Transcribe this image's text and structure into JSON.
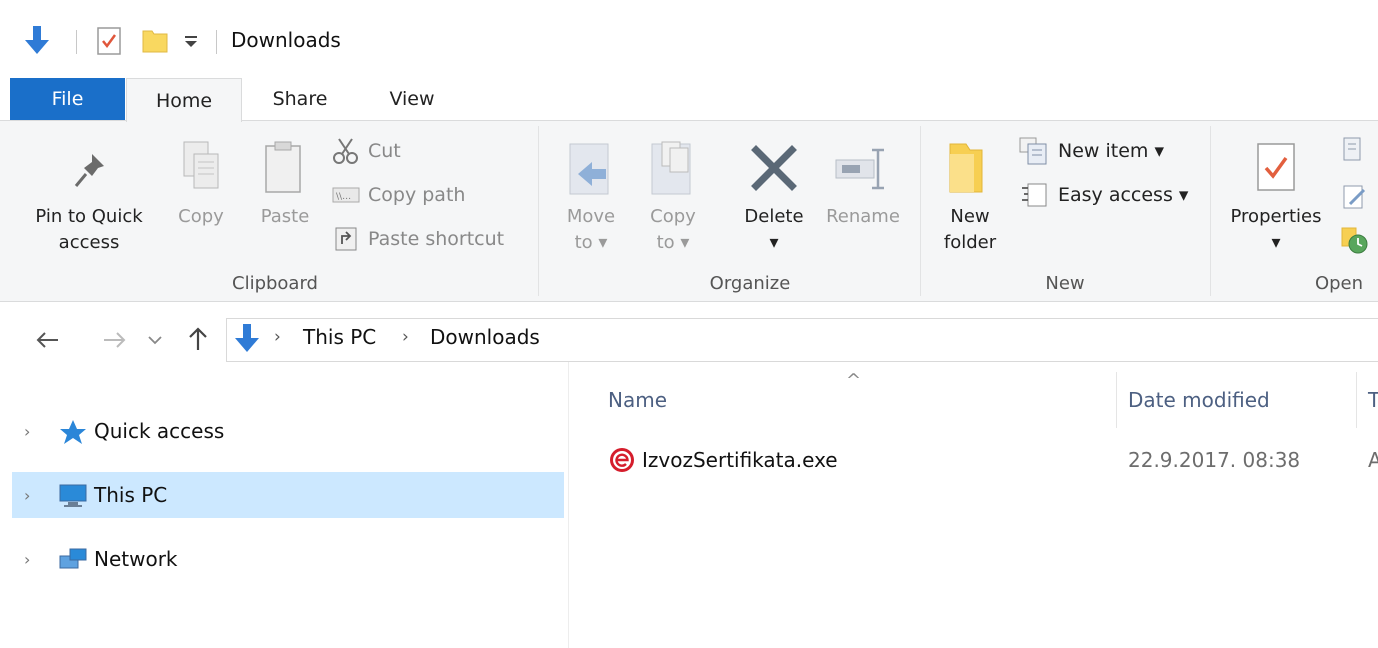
{
  "window": {
    "title": "Downloads"
  },
  "tabs": [
    {
      "label": "File"
    },
    {
      "label": "Home"
    },
    {
      "label": "Share"
    },
    {
      "label": "View"
    }
  ],
  "ribbon": {
    "clipboard": {
      "label": "Clipboard",
      "pin_line1": "Pin to Quick",
      "pin_line2": "access",
      "copy": "Copy",
      "paste": "Paste",
      "cut": "Cut",
      "copy_path": "Copy path",
      "paste_shortcut": "Paste shortcut"
    },
    "organize": {
      "label": "Organize",
      "move_line1": "Move",
      "move_line2": "to ▾",
      "copy_line1": "Copy",
      "copy_line2": "to ▾",
      "delete": "Delete",
      "delete_arrow": "▾",
      "rename": "Rename"
    },
    "new": {
      "label": "New",
      "folder_line1": "New",
      "folder_line2": "folder",
      "new_item": "New item ▾",
      "easy_access": "Easy access ▾"
    },
    "open": {
      "label": "Open",
      "properties": "Properties",
      "properties_arrow": "▾"
    }
  },
  "address": {
    "sep": "›",
    "crumbs": [
      "This PC",
      "Downloads"
    ]
  },
  "nav_pane": {
    "items": [
      {
        "label": "Quick access",
        "chevron": "›"
      },
      {
        "label": "This PC",
        "chevron": "›"
      },
      {
        "label": "Network",
        "chevron": "›"
      }
    ]
  },
  "file_list": {
    "sort_indicator": "^",
    "columns": [
      "Name",
      "Date modified",
      "T"
    ],
    "rows": [
      {
        "name": "IzvozSertifikata.exe",
        "date": "22.9.2017. 08:38",
        "type": "A"
      }
    ]
  },
  "colors": {
    "file_tab": "#1a6fc9",
    "selection": "#cce8ff",
    "column_header": "#4d6082"
  }
}
